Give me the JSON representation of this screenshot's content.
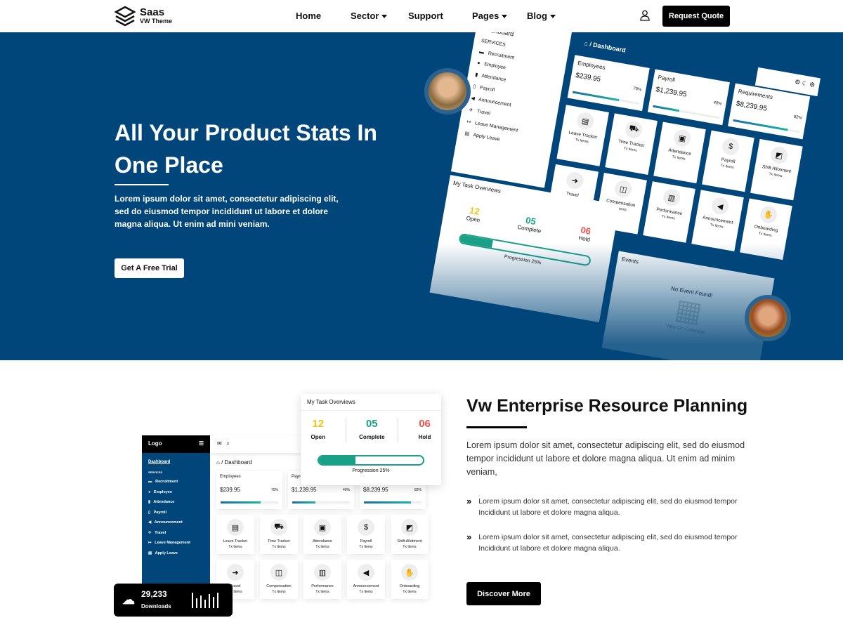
{
  "brand": {
    "name": "Saas",
    "tagline": "VW Theme"
  },
  "nav": [
    {
      "label": "Home"
    },
    {
      "label": "Sector",
      "dropdown": true
    },
    {
      "label": "Support"
    },
    {
      "label": "Pages",
      "dropdown": true
    },
    {
      "label": "Blog",
      "dropdown": true
    }
  ],
  "header": {
    "quote_label": "Request Quote",
    "user_icon": "user-icon"
  },
  "hero": {
    "title": "All Your Product Stats In One Place",
    "text": "Lorem ipsum dolor sit amet, consectetur adipiscing elit, sed do eiusmod tempor incididunt ut labore et dolore magna aliqua. Ut enim ad mini veniam.",
    "cta": "Get A Free Trial"
  },
  "dashboard": {
    "logo": "Logo",
    "dashboard_link": "Dashboard",
    "services": "SERVICES",
    "breadcrumb": "/ Dashboard",
    "sidebar": [
      "Recruitment",
      "Employee",
      "Attendance",
      "Payroll",
      "Announcement",
      "Travel",
      "Leave Management",
      "Apply Leave"
    ],
    "cards": [
      {
        "label": "Employees",
        "value": "$239.95",
        "percent": "70%",
        "progress": 70
      },
      {
        "label": "Payroll",
        "value": "$1,239.95",
        "percent": "40%",
        "progress": 40
      },
      {
        "label": "Requirements",
        "value": "$8,239.95",
        "percent": "82%",
        "progress": 82
      }
    ],
    "tiles": [
      {
        "label": "Leave Tracker",
        "icon": "▤"
      },
      {
        "label": "Time Tracker",
        "icon": "⛟"
      },
      {
        "label": "Attendance",
        "icon": "▣"
      },
      {
        "label": "Payroll",
        "icon": "$"
      },
      {
        "label": "Shift Allotment",
        "icon": "◩"
      },
      {
        "label": "Travel",
        "icon": "➜"
      },
      {
        "label": "Compensation",
        "icon": "◫"
      },
      {
        "label": "Performance",
        "icon": "▥"
      },
      {
        "label": "Announcement",
        "icon": "◀"
      },
      {
        "label": "Onboarding",
        "icon": "✋"
      }
    ],
    "tile_sub": "Tx Items",
    "task": {
      "title": "My Task Overviews",
      "open": "12",
      "open_label": "Open",
      "complete": "05",
      "complete_label": "Complete",
      "hold": "06",
      "hold_label": "Hold",
      "progress_label": "Progression 25%",
      "progress": 25
    },
    "events": {
      "title": "Events",
      "empty": "No Event Found!",
      "link": "View On Calendar"
    }
  },
  "colors": {
    "primary": "#00467a",
    "open": "#f0c419",
    "complete": "#19a087",
    "hold": "#f0524f"
  },
  "downloads": {
    "count": "29,233",
    "label": "Downloads"
  },
  "erp": {
    "title": "Vw Enterprise Resource Planning",
    "text": "Lorem ipsum dolor sit amet, consectetur adipiscing elit, sed do eiusmod tempor incididunt ut labore et dolore magna aliqua. Ut enim ad minim veniam,",
    "items": [
      "Lorem ipsum dolor sit amet, consectetur adipiscing elit, sed do eiusmod tempor Incididunt ut labore et dolore magna aliqua.",
      "Lorem ipsum dolor sit amet, consectetur adipiscing elit, sed do eiusmod tempor Incididunt ut labore et dolore magna aliqua."
    ],
    "cta": "Discover More"
  }
}
